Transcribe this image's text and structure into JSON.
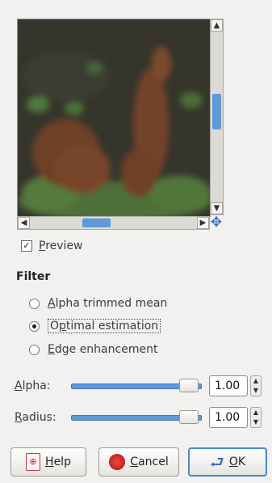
{
  "preview": {
    "checkbox_checked": true,
    "checkbox_mark": "✓",
    "label_mnemonic": "P",
    "label_rest": "review"
  },
  "scrollbars": {
    "up_arrow": "▲",
    "down_arrow": "▼",
    "left_arrow": "◀",
    "right_arrow": "▶",
    "navigate_icon": "✥"
  },
  "filter": {
    "title": "Filter",
    "options": [
      {
        "mnemonic": "A",
        "rest": "lpha trimmed mean",
        "selected": false
      },
      {
        "mnemonic": "p",
        "rest": "timal estimation",
        "prefix": "O",
        "selected": true
      },
      {
        "mnemonic": "E",
        "rest": "dge enhancement",
        "selected": false
      }
    ]
  },
  "alpha": {
    "label_mnemonic": "A",
    "label_rest": "lpha:",
    "value": "1.00",
    "slider_fraction": 1.0
  },
  "radius": {
    "label_mnemonic": "R",
    "label_rest": "adius:",
    "value": "1.00",
    "slider_fraction": 1.0
  },
  "spin_arrows": {
    "up": "▲",
    "down": "▼"
  },
  "buttons": {
    "help": {
      "mnemonic": "H",
      "rest": "elp"
    },
    "cancel": {
      "mnemonic": "C",
      "rest": "ancel"
    },
    "ok": {
      "mnemonic": "O",
      "rest": "K"
    }
  },
  "colors": {
    "accent": "#5f9ad8",
    "default_border": "#4a87cf"
  }
}
